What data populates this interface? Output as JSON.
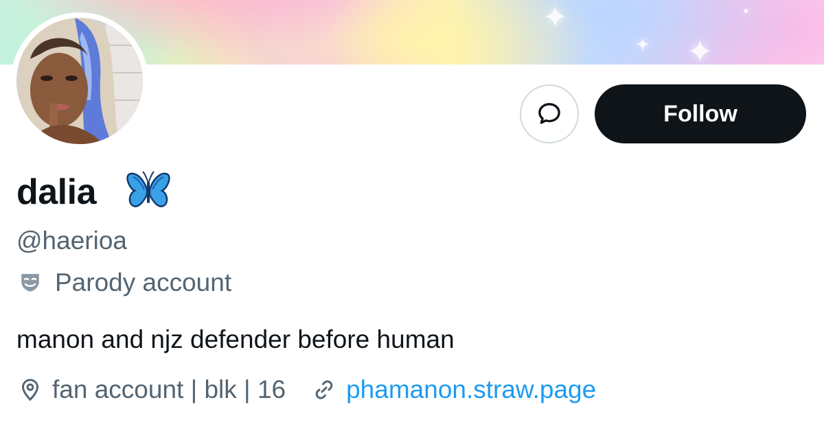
{
  "profile": {
    "display_name": "dalia",
    "handle": "@haerioa",
    "parody_label": "Parody account",
    "bio": "manon and njz defender before human",
    "location": "fan account | blk | 16",
    "website": "phamanon.straw.page"
  },
  "actions": {
    "follow_label": "Follow",
    "message_icon": "message-bubble-icon"
  },
  "icons": {
    "name_emoji": "butterfly-icon",
    "parody": "theater-mask-icon",
    "location": "location-pin-icon",
    "link": "link-icon"
  },
  "colors": {
    "follow_bg": "#0f1419",
    "secondary_text": "#536471",
    "link": "#1d9bf0",
    "border": "#cfd9de"
  }
}
